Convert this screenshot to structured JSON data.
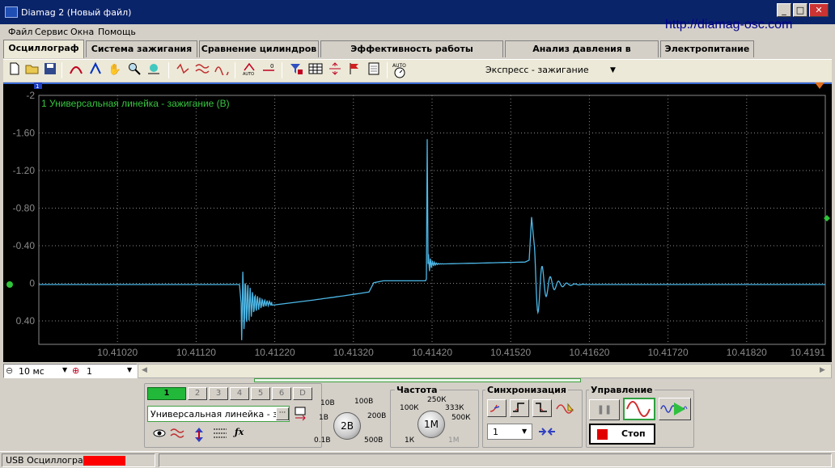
{
  "window": {
    "title": "Diamag 2 (Новый файл)",
    "buttons": [
      "_",
      "□",
      "✕"
    ]
  },
  "menu": [
    "Файл",
    "Сервис",
    "Окна",
    "Помощь"
  ],
  "url": "http://diamag-osc.com",
  "tabs": [
    "Осциллограф",
    "Система зажигания",
    "Сравнение цилиндров",
    "Эффективность работы цилиндров",
    "Анализ давления в цилиндре",
    "Электропитание"
  ],
  "toolbar": {
    "mode": "Экспресс - зажигание"
  },
  "scope": {
    "channel_label": "1 Универсальная линейка - зажигание (В)",
    "colors": {
      "trace": "#4db8e8",
      "grid": "#8a8a8a",
      "label": "#36c440",
      "marker": "#2fc43a"
    },
    "y_ticks": [
      "-2",
      "-1.60",
      "-1.20",
      "-0.80",
      "-0.40",
      "0",
      "0.40"
    ],
    "x_ticks": [
      "10.41020",
      "10.41120",
      "10.41220",
      "10.41320",
      "10.41420",
      "10.41520",
      "10.41620",
      "10.41720",
      "10.41820",
      "10.4191"
    ],
    "left_marker": "1"
  },
  "timebase": {
    "value": "10 мс",
    "zoom": "1"
  },
  "channels": [
    "1",
    "2",
    "3",
    "4",
    "5",
    "6",
    "D"
  ],
  "probe": {
    "value": "Универсальная линейка - за"
  },
  "voltage_knob": {
    "value": "2В",
    "labels": [
      "10В",
      "100В",
      "1В",
      "200В",
      "0.1В",
      "500В"
    ]
  },
  "frequency": {
    "title": "Частота",
    "value": "1М",
    "labels": [
      "250К",
      "100К",
      "333К",
      "500К",
      "1К",
      "1М"
    ]
  },
  "sync": {
    "title": "Синхронизация",
    "value": "1"
  },
  "control": {
    "title": "Управление",
    "stop_label": "Стоп"
  },
  "status": {
    "device": "USB Осциллограф"
  }
}
